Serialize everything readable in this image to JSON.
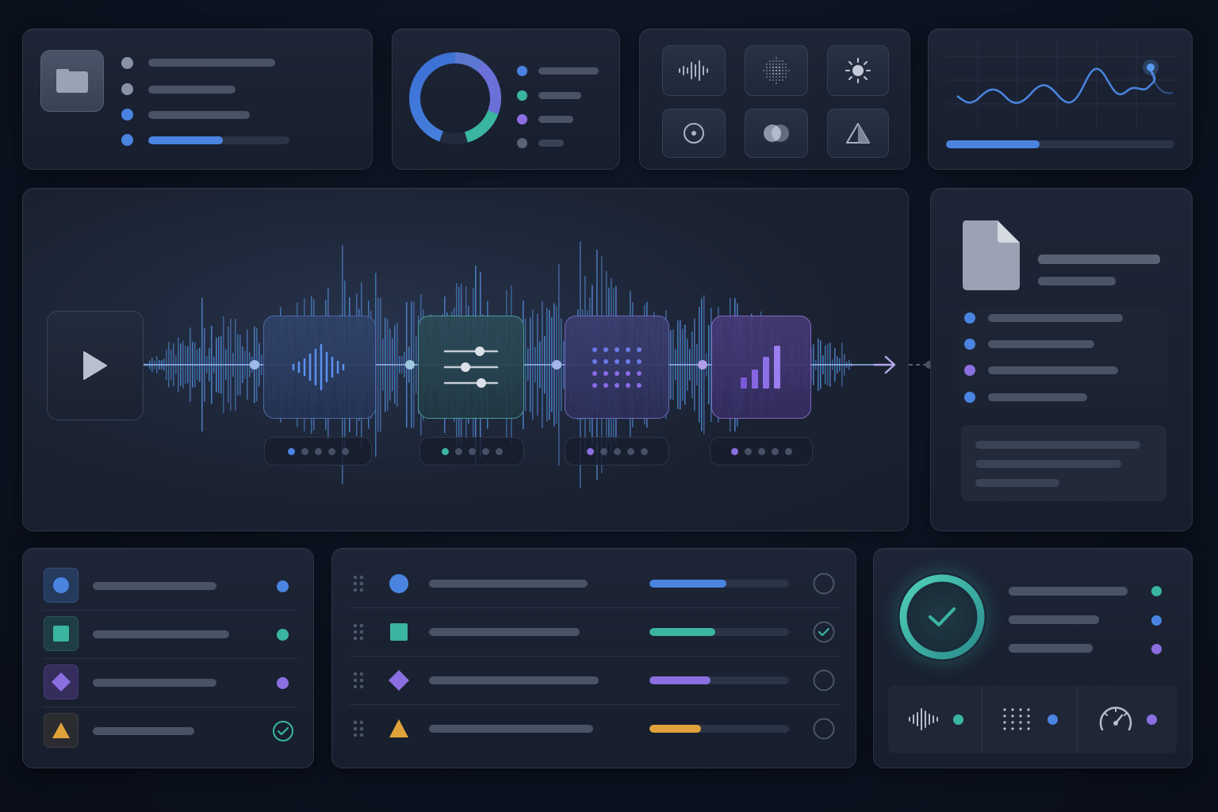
{
  "colors": {
    "blue": "#4a84e0",
    "teal": "#3ab5a0",
    "purple": "#8b6fe0",
    "amber": "#e0a23a",
    "grey": "#8a93a6"
  },
  "top_left_card": {
    "icon": "folder-icon",
    "rows": [
      {
        "dot_color": "grey"
      },
      {
        "dot_color": "grey"
      },
      {
        "dot_color": "blue"
      },
      {
        "dot_color": "blue",
        "progress": 0.53
      }
    ]
  },
  "donut_card": {
    "segments": [
      {
        "color": "blue",
        "fraction": 0.55
      },
      {
        "color": "teal",
        "fraction": 0.15
      },
      {
        "color": "purple",
        "fraction": 0.2
      },
      {
        "color": "blue",
        "fraction": 0.1
      }
    ],
    "legend": [
      "blue",
      "teal",
      "purple",
      "grey"
    ]
  },
  "tools_card": {
    "icons": [
      "waveform-icon",
      "dot-sphere-icon",
      "sun-icon",
      "target-icon",
      "overlap-circles-icon",
      "triangle-icon"
    ]
  },
  "line_chart_card": {
    "progress": 0.41
  },
  "pipeline": {
    "play_icon": "play-icon",
    "stages": [
      {
        "icon": "waveform-icon",
        "color": "blue"
      },
      {
        "icon": "sliders-icon",
        "color": "teal"
      },
      {
        "icon": "dot-grid-icon",
        "color": "purple"
      },
      {
        "icon": "bar-chart-icon",
        "color": "purple"
      }
    ],
    "arrow_icon": "arrow-right-icon"
  },
  "document_card": {
    "icon": "document-icon",
    "list_dots": [
      "blue",
      "blue",
      "purple",
      "blue"
    ]
  },
  "bottom_left_list": {
    "items": [
      {
        "shape": "circle-icon",
        "color": "blue",
        "status": "dot"
      },
      {
        "shape": "square-icon",
        "color": "teal",
        "status": "dot"
      },
      {
        "shape": "diamond-icon",
        "color": "purple",
        "status": "dot"
      },
      {
        "shape": "triangle-icon",
        "color": "amber",
        "status": "check-icon"
      }
    ]
  },
  "task_list": {
    "rows": [
      {
        "shape": "circle-icon",
        "color": "blue",
        "progress": 0.55,
        "checked": false
      },
      {
        "shape": "square-icon",
        "color": "teal",
        "progress": 0.47,
        "checked": true
      },
      {
        "shape": "diamond-icon",
        "color": "purple",
        "progress": 0.44,
        "checked": false
      },
      {
        "shape": "triangle-icon",
        "color": "amber",
        "progress": 0.37,
        "checked": false
      }
    ]
  },
  "status_card": {
    "icon": "check-icon",
    "dots": [
      "teal",
      "blue",
      "purple"
    ],
    "footer": [
      {
        "icon": "waveform-icon",
        "color": "teal"
      },
      {
        "icon": "dot-grid-icon",
        "color": "blue"
      },
      {
        "icon": "gauge-icon",
        "color": "purple"
      }
    ]
  }
}
